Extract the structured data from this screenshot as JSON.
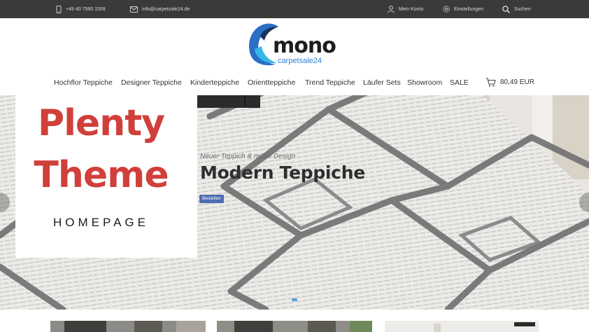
{
  "topbar": {
    "phone": "+49 40 7560 1509",
    "email": "info@carpetsale24.de",
    "account": "Mein Konto",
    "settings": "Einstellungen",
    "search": "Suchen"
  },
  "logo": {
    "word": "mono",
    "sub": "carpetsale24"
  },
  "nav": {
    "items": [
      "Hochflor Teppiche",
      "Designer Teppiche",
      "Kinderteppiche",
      "Orientteppiche",
      "Trend Teppiche",
      "Läufer Sets",
      "Showroom",
      "SALE"
    ],
    "cart_total": "80,49 EUR"
  },
  "hero": {
    "kicker": "Neuer Teppich & neuer Design",
    "title": "Modern Teppiche",
    "button": "Bestellen"
  },
  "overlay": {
    "line1": "Plenty",
    "line2": "Theme",
    "sub": "HOMEPAGE"
  },
  "colors": {
    "topbar": "#3a3a3a",
    "accent_red": "#d13f3a",
    "button_blue": "#4f6cb4",
    "logo_blue": "#2a7fd4"
  }
}
